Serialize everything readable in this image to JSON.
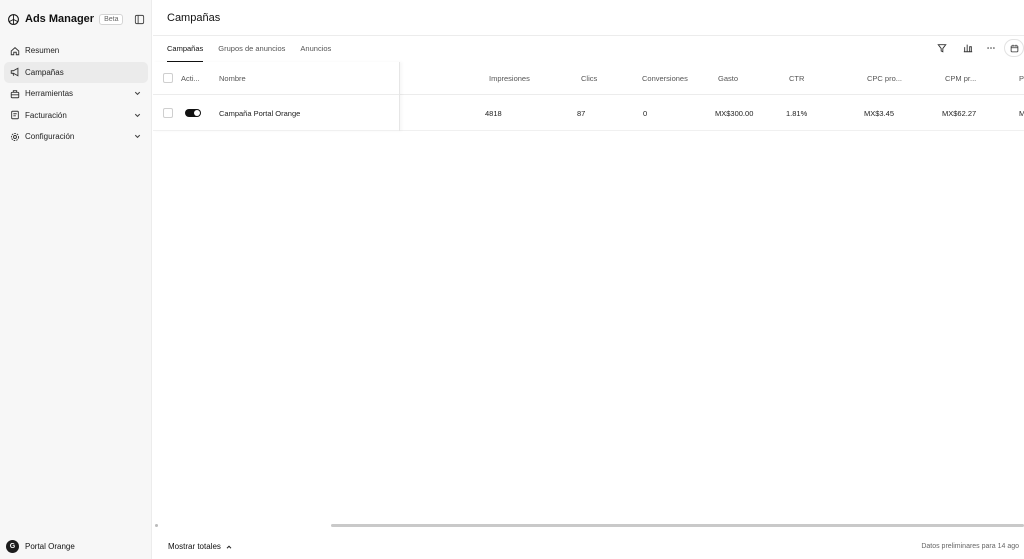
{
  "brand": {
    "name": "Ads Manager",
    "badge": "Beta"
  },
  "sidebar": {
    "items": [
      {
        "label": "Resumen",
        "icon": "home-icon",
        "active": false,
        "expandable": false
      },
      {
        "label": "Campañas",
        "icon": "megaphone-icon",
        "active": true,
        "expandable": false
      },
      {
        "label": "Herramientas",
        "icon": "toolbox-icon",
        "active": false,
        "expandable": true
      },
      {
        "label": "Facturación",
        "icon": "receipt-icon",
        "active": false,
        "expandable": true
      },
      {
        "label": "Configuración",
        "icon": "gear-icon",
        "active": false,
        "expandable": true
      }
    ]
  },
  "account": {
    "initial": "G",
    "name": "Portal Orange"
  },
  "page": {
    "title": "Campañas"
  },
  "tabs": [
    {
      "label": "Campañas",
      "active": true
    },
    {
      "label": "Grupos de anuncios",
      "active": false
    },
    {
      "label": "Anuncios",
      "active": false
    }
  ],
  "toolbar": {
    "icons": [
      "filter-icon",
      "columns-icon",
      "more-icon",
      "calendar-icon"
    ]
  },
  "table": {
    "headers": {
      "active": "Acti...",
      "name": "Nombre",
      "impressions": "Impresiones",
      "clicks": "Clics",
      "conversions": "Conversiones",
      "spend": "Gasto",
      "ctr": "CTR",
      "cpc": "CPC pro...",
      "cpm": "CPM pr...",
      "extra": "P"
    },
    "rows": [
      {
        "active": true,
        "name": "Campaña Portal Orange",
        "impressions": "4818",
        "clicks": "87",
        "conversions": "0",
        "spend": "MX$300.00",
        "ctr": "1.81%",
        "cpc": "MX$3.45",
        "cpm": "MX$62.27",
        "extra": "M"
      }
    ]
  },
  "footer": {
    "totals_label": "Mostrar totales",
    "note": "Datos preliminares para 14 ago"
  }
}
